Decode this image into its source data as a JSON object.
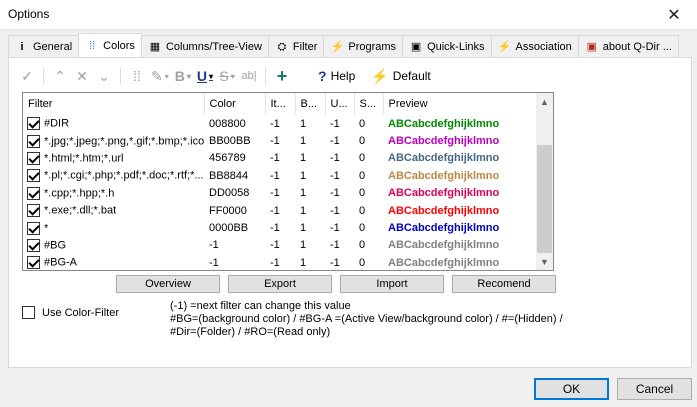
{
  "window": {
    "title": "Options",
    "close_glyph": "✕"
  },
  "tabs": [
    {
      "label": "General",
      "icon": "i"
    },
    {
      "label": "Colors",
      "icon": "⁞⁞"
    },
    {
      "label": "Columns/Tree-View",
      "icon": "▦"
    },
    {
      "label": "Filter",
      "icon": "⛭"
    },
    {
      "label": "Programs",
      "icon": "⚡"
    },
    {
      "label": "Quick-Links",
      "icon": "▣"
    },
    {
      "label": "Association",
      "icon": "⚡"
    },
    {
      "label": "about Q-Dir ...",
      "icon": "▣"
    }
  ],
  "toolbar": {
    "help_label": "Help",
    "default_label": "Default",
    "check_glyph": "✓",
    "up_glyph": "⌃",
    "delete_glyph": "✕",
    "down_glyph": "⌄",
    "dots_glyph": "⁞⁞",
    "pen_glyph": "✎",
    "bold_glyph": "B",
    "underline_glyph": "U",
    "strike_glyph": "S",
    "abc_glyph": "ab|",
    "add_glyph": "+",
    "help_glyph": "?",
    "default_glyph": "⚡",
    "caret": "▾"
  },
  "grid": {
    "columns": [
      "Filter",
      "Color",
      "It...",
      "B...",
      "U...",
      "S...",
      "Preview"
    ],
    "rows": [
      {
        "filter": "#DIR",
        "color": "008800",
        "it": "-1",
        "b": "1",
        "u": "-1",
        "s": "0",
        "preview": "ABCabcdefghijklmno",
        "preview_color": "#008800"
      },
      {
        "filter": "*.jpg;*.jpeg;*.png,*.gif;*.bmp;*.ico",
        "color": "BB00BB",
        "it": "-1",
        "b": "1",
        "u": "-1",
        "s": "0",
        "preview": "ABCabcdefghijklmno",
        "preview_color": "#BB00BB"
      },
      {
        "filter": "*.html;*.htm;*.url",
        "color": "456789",
        "it": "-1",
        "b": "1",
        "u": "-1",
        "s": "0",
        "preview": "ABCabcdefghijklmno",
        "preview_color": "#456789"
      },
      {
        "filter": "*.pl;*.cgi;*.php;*.pdf;*.doc;*.rtf;*...",
        "color": "BB8844",
        "it": "-1",
        "b": "1",
        "u": "-1",
        "s": "0",
        "preview": "ABCabcdefghijklmno",
        "preview_color": "#BB8844"
      },
      {
        "filter": "*.cpp;*.hpp;*.h",
        "color": "DD0058",
        "it": "-1",
        "b": "1",
        "u": "-1",
        "s": "0",
        "preview": "ABCabcdefghijklmno",
        "preview_color": "#DD0058"
      },
      {
        "filter": "*.exe;*.dll;*.bat",
        "color": "FF0000",
        "it": "-1",
        "b": "1",
        "u": "-1",
        "s": "0",
        "preview": "ABCabcdefghijklmno",
        "preview_color": "#FF0000"
      },
      {
        "filter": "*",
        "color": "0000BB",
        "it": "-1",
        "b": "1",
        "u": "-1",
        "s": "0",
        "preview": "ABCabcdefghijklmno",
        "preview_color": "#0000BB"
      },
      {
        "filter": "#BG",
        "color": "-1",
        "it": "-1",
        "b": "1",
        "u": "-1",
        "s": "0",
        "preview": "ABCabcdefghijklmno",
        "preview_color": "#808080"
      },
      {
        "filter": "#BG-A",
        "color": "-1",
        "it": "-1",
        "b": "1",
        "u": "-1",
        "s": "0",
        "preview": "ABCabcdefghijklmno",
        "preview_color": "#808080"
      }
    ]
  },
  "scrollbar": {
    "up": "▲",
    "down": "▼"
  },
  "buttons": {
    "overview": "Overview",
    "export": "Export",
    "import": "Import",
    "recomend": "Recomend"
  },
  "use_color_filter": {
    "label": "Use Color-Filter",
    "checked": false
  },
  "help_text": {
    "line1": "(-1) =next filter can change this value",
    "line2": "#BG=(background color) / #BG-A =(Active View/background color) / #=(Hidden) /",
    "line3": "#Dir=(Folder) / #RO=(Read only)"
  },
  "footer": {
    "ok_label": "OK",
    "cancel_label": "Cancel"
  }
}
